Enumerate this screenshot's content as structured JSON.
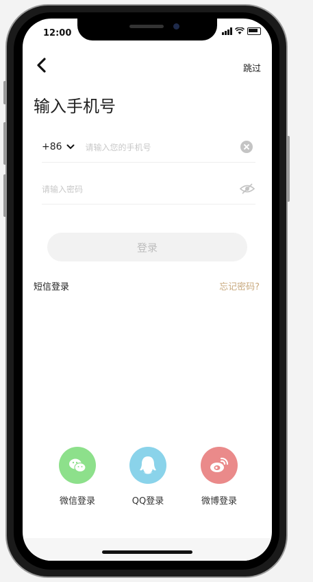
{
  "status": {
    "time": "12:00"
  },
  "nav": {
    "skip_label": "跳过"
  },
  "page": {
    "title": "输入手机号"
  },
  "phone_field": {
    "country_code": "+86",
    "placeholder": "请输入您的手机号"
  },
  "password_field": {
    "placeholder": "请输入密码"
  },
  "login_button": {
    "label": "登录"
  },
  "links": {
    "sms_login": "短信登录",
    "forgot_password": "忘记密码?"
  },
  "social": [
    {
      "label": "微信登录",
      "icon": "wechat-icon",
      "color": "#8de08b"
    },
    {
      "label": "QQ登录",
      "icon": "qq-icon",
      "color": "#8ad3ea"
    },
    {
      "label": "微博登录",
      "icon": "weibo-icon",
      "color": "#ea8a8a"
    }
  ],
  "colors": {
    "accent": "#c8a97e",
    "button_bg": "#f2f2f2"
  }
}
